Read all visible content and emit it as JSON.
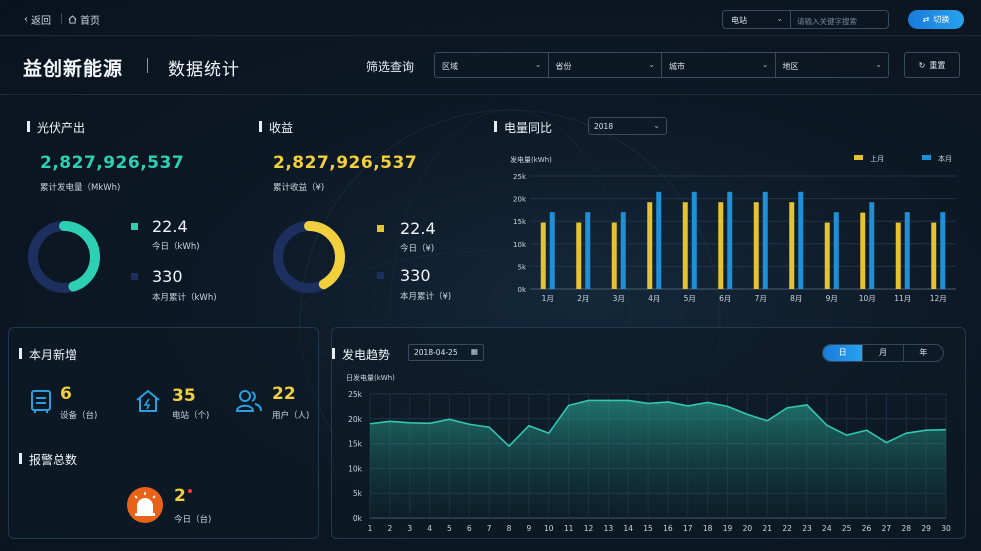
{
  "nav": {
    "back": "返回",
    "home": "首页"
  },
  "search": {
    "type": "电站",
    "placeholder": "请输入关键字搜索",
    "switch_label": "切换"
  },
  "header": {
    "brand": "益创新能源",
    "title": "数据统计",
    "filter_label": "筛选查询",
    "filters": [
      "区域",
      "省份",
      "城市",
      "地区"
    ],
    "reset": "重置"
  },
  "pv": {
    "title": "光伏产出",
    "total": "2,827,926,537",
    "total_label": "累计发电量（MkWh)",
    "today": "22.4",
    "today_label": "今日（kWh)",
    "month": "330",
    "month_label": "本月累计（kWh)",
    "ratio": 0.45,
    "color": "#2ed0b4",
    "track": "#1c2f5e"
  },
  "revenue": {
    "title": "收益",
    "total": "2,827,926,537",
    "total_label": "累计收益（¥)",
    "today": "22.4",
    "today_label": "今日（¥)",
    "month": "330",
    "month_label": "本月累计（¥)",
    "ratio": 0.42,
    "color": "#f2cf3d",
    "track": "#1c2f5e"
  },
  "compare": {
    "title": "电量同比",
    "year": "2018"
  },
  "monthly": {
    "title": "本月新增",
    "items": [
      {
        "value": "6",
        "label": "设备（台)",
        "icon": "device-icon"
      },
      {
        "value": "35",
        "label": "电站（个)",
        "icon": "station-icon"
      },
      {
        "value": "22",
        "label": "用户（人)",
        "icon": "users-icon"
      }
    ]
  },
  "alarm": {
    "title": "报警总数",
    "value": "2",
    "label": "今日（台)"
  },
  "trend": {
    "title": "发电趋势",
    "date": "2018-04-25",
    "tabs": [
      "日",
      "月",
      "年"
    ],
    "active_tab": "日"
  },
  "chart_data": [
    {
      "type": "bar",
      "ylabel": "发电量(kWh)",
      "categories": [
        "1月",
        "2月",
        "3月",
        "4月",
        "5月",
        "6月",
        "7月",
        "8月",
        "9月",
        "10月",
        "11月",
        "12月"
      ],
      "yticks": [
        "0k",
        "5k",
        "10k",
        "15k",
        "20k",
        "25k"
      ],
      "ylim": [
        0,
        25000
      ],
      "series": [
        {
          "name": "上月",
          "color": "#e5c232",
          "values": [
            14700,
            14700,
            14700,
            19200,
            19200,
            19200,
            19200,
            19200,
            14700,
            16900,
            14700,
            14700
          ]
        },
        {
          "name": "本月",
          "color": "#1f8fd6",
          "values": [
            17000,
            17000,
            17000,
            21500,
            21500,
            21500,
            21500,
            21500,
            17000,
            19200,
            17000,
            17000
          ]
        }
      ],
      "legend": "top-right",
      "grid": true
    },
    {
      "type": "area",
      "ylabel": "日发电量(kWh)",
      "x": [
        "1",
        "2",
        "3",
        "4",
        "5",
        "6",
        "7",
        "8",
        "9",
        "10",
        "11",
        "12",
        "13",
        "14",
        "15",
        "16",
        "17",
        "18",
        "19",
        "20",
        "21",
        "22",
        "23",
        "24",
        "25",
        "26",
        "27",
        "28",
        "29",
        "30"
      ],
      "yticks": [
        "0k",
        "5k",
        "10k",
        "15k",
        "20k",
        "25k"
      ],
      "ylim": [
        0,
        25000
      ],
      "series": [
        {
          "color": "#33c6b0",
          "values": [
            19000,
            19500,
            19200,
            19100,
            19900,
            18900,
            18300,
            14500,
            18600,
            17100,
            22700,
            23700,
            23700,
            23700,
            23100,
            23400,
            22600,
            23300,
            22500,
            20900,
            19600,
            22200,
            22800,
            18700,
            16700,
            17700,
            15200,
            17100,
            17700,
            17800
          ]
        }
      ],
      "grid": true
    }
  ]
}
